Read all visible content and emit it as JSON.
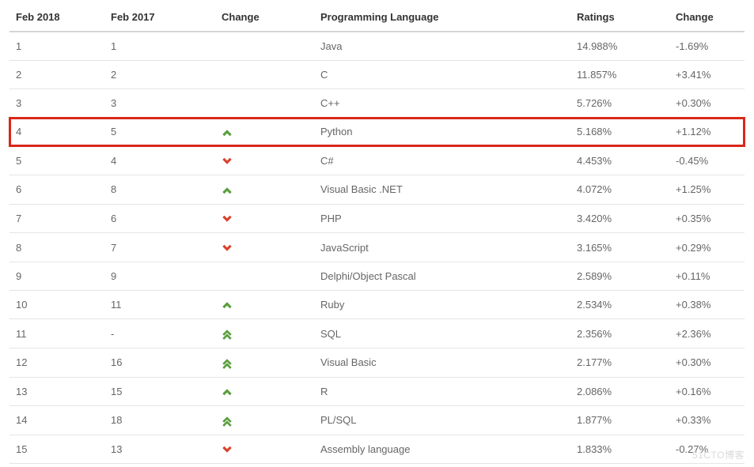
{
  "chart_data": {
    "type": "table",
    "title": "",
    "columns": [
      "Feb 2018",
      "Feb 2017",
      "Change",
      "Programming Language",
      "Ratings",
      "Change"
    ],
    "highlight_row_index": 3,
    "watermark": "51CTO博客",
    "rows": [
      {
        "feb2018": "1",
        "feb2017": "1",
        "trend": "",
        "language": "Java",
        "ratings": "14.988%",
        "delta": "-1.69%"
      },
      {
        "feb2018": "2",
        "feb2017": "2",
        "trend": "",
        "language": "C",
        "ratings": "11.857%",
        "delta": "+3.41%"
      },
      {
        "feb2018": "3",
        "feb2017": "3",
        "trend": "",
        "language": "C++",
        "ratings": "5.726%",
        "delta": "+0.30%"
      },
      {
        "feb2018": "4",
        "feb2017": "5",
        "trend": "up",
        "language": "Python",
        "ratings": "5.168%",
        "delta": "+1.12%"
      },
      {
        "feb2018": "5",
        "feb2017": "4",
        "trend": "down",
        "language": "C#",
        "ratings": "4.453%",
        "delta": "-0.45%"
      },
      {
        "feb2018": "6",
        "feb2017": "8",
        "trend": "up",
        "language": "Visual Basic .NET",
        "ratings": "4.072%",
        "delta": "+1.25%"
      },
      {
        "feb2018": "7",
        "feb2017": "6",
        "trend": "down",
        "language": "PHP",
        "ratings": "3.420%",
        "delta": "+0.35%"
      },
      {
        "feb2018": "8",
        "feb2017": "7",
        "trend": "down",
        "language": "JavaScript",
        "ratings": "3.165%",
        "delta": "+0.29%"
      },
      {
        "feb2018": "9",
        "feb2017": "9",
        "trend": "",
        "language": "Delphi/Object Pascal",
        "ratings": "2.589%",
        "delta": "+0.11%"
      },
      {
        "feb2018": "10",
        "feb2017": "11",
        "trend": "up",
        "language": "Ruby",
        "ratings": "2.534%",
        "delta": "+0.38%"
      },
      {
        "feb2018": "11",
        "feb2017": "-",
        "trend": "double-up",
        "language": "SQL",
        "ratings": "2.356%",
        "delta": "+2.36%"
      },
      {
        "feb2018": "12",
        "feb2017": "16",
        "trend": "double-up",
        "language": "Visual Basic",
        "ratings": "2.177%",
        "delta": "+0.30%"
      },
      {
        "feb2018": "13",
        "feb2017": "15",
        "trend": "up",
        "language": "R",
        "ratings": "2.086%",
        "delta": "+0.16%"
      },
      {
        "feb2018": "14",
        "feb2017": "18",
        "trend": "double-up",
        "language": "PL/SQL",
        "ratings": "1.877%",
        "delta": "+0.33%"
      },
      {
        "feb2018": "15",
        "feb2017": "13",
        "trend": "down",
        "language": "Assembly language",
        "ratings": "1.833%",
        "delta": "-0.27%"
      }
    ]
  }
}
